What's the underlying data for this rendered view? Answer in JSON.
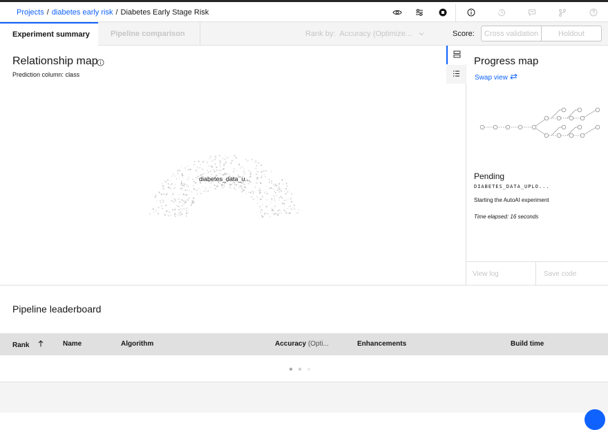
{
  "breadcrumb": {
    "projects": "Projects",
    "sep1": "/",
    "project": "diabetes early risk",
    "sep2": "/",
    "current": "Diabetes Early Stage Risk"
  },
  "header_icons": [
    "eye-icon",
    "sliders-icon",
    "stop-icon",
    "info-icon",
    "history-icon",
    "chat-icon",
    "branch-icon",
    "help-icon"
  ],
  "tabs": {
    "experiment_summary": "Experiment summary",
    "pipeline_comparison": "Pipeline comparison"
  },
  "rank_by": {
    "label": "Rank by:",
    "value": "Accuracy (Optimize..."
  },
  "score": {
    "label": "Score:",
    "cross_validation": "Cross validation",
    "holdout": "Holdout"
  },
  "relationship_map": {
    "title": "Relationship map",
    "prediction_label": "Prediction column:",
    "prediction_value": "class",
    "node_label": "diabetes_data_u..."
  },
  "progress_map": {
    "title": "Progress map",
    "swap_view": "Swap view",
    "status_title": "Pending",
    "dataset": "DIABETES_DATA_UPLO...",
    "status_message": "Starting the AutoAI experiment",
    "time_elapsed": "Time elapsed: 16 seconds",
    "view_log": "View log",
    "save_code": "Save code"
  },
  "leaderboard": {
    "title": "Pipeline leaderboard",
    "columns": {
      "rank": "Rank",
      "name": "Name",
      "algorithm": "Algorithm",
      "accuracy": "Accuracy",
      "accuracy_suffix": "(Opti...",
      "enhancements": "Enhancements",
      "build_time": "Build time"
    }
  },
  "colors": {
    "accent": "#0f62fe",
    "disabled_text": "#c6c6c6",
    "border": "#e0e0e0"
  }
}
